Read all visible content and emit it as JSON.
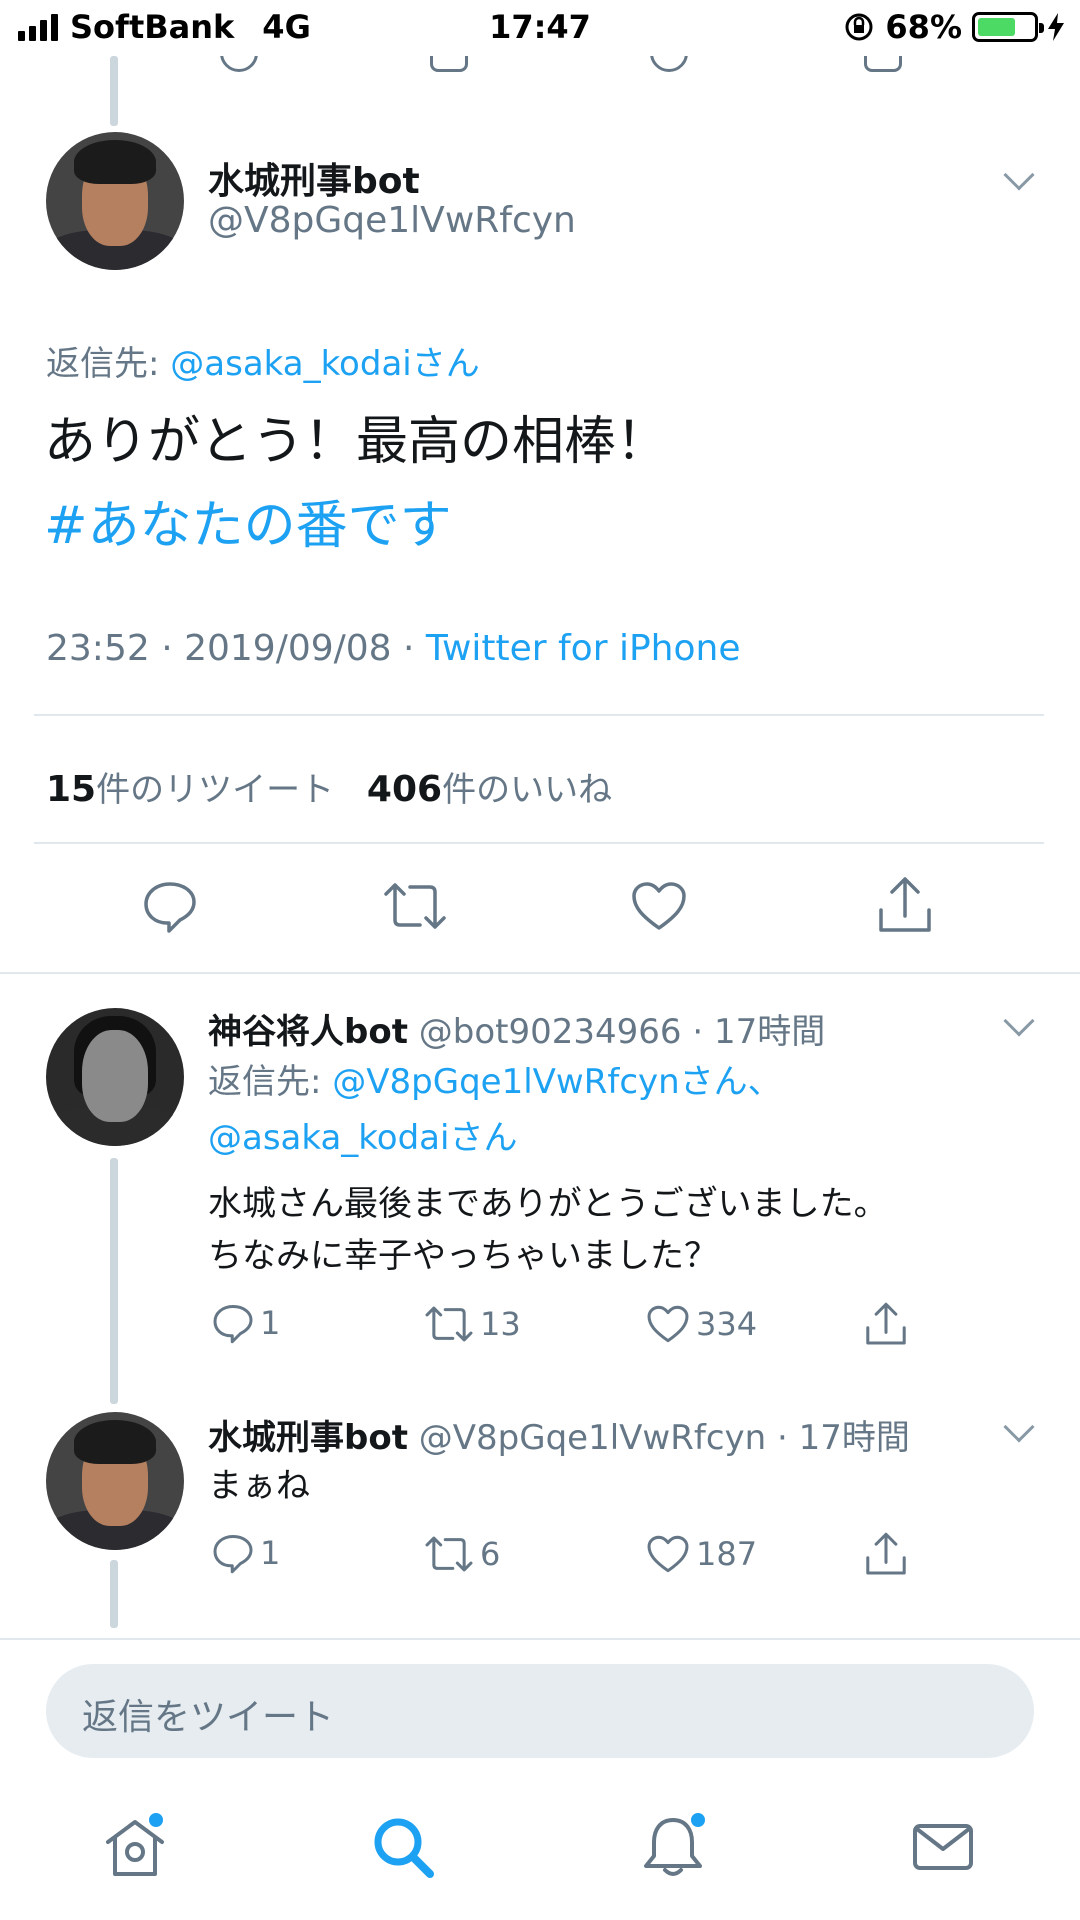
{
  "status_bar": {
    "carrier": "SoftBank",
    "network": "4G",
    "time": "17:47",
    "battery": "68%",
    "battery_level": 0.68,
    "icons": [
      "signal-icon",
      "rotation-lock-icon",
      "battery-icon",
      "charging-icon"
    ]
  },
  "main_tweet": {
    "name": "水城刑事bot",
    "handle": "@V8pGqe1lVwRfcyn",
    "reply_prefix": "返信先: ",
    "reply_to": "@asaka_kodaiさん",
    "text": "ありがとう！最高の相棒！",
    "hashtag": "#あなたの番です",
    "timestamp": "23:52 · 2019/09/08 · ",
    "source": "Twitter for iPhone",
    "retweet_count": "15",
    "retweet_label": "件のリツイート",
    "like_count": "406",
    "like_label": "件のいいね"
  },
  "replies": [
    {
      "name": "神谷将人bot",
      "handle": "@bot90234966 · 17時間",
      "reply_prefix": "返信先: ",
      "reply_to_1": "@V8pGqe1lVwRfcynさん、",
      "reply_to_2": "@asaka_kodaiさん",
      "text_1": "水城さん最後までありがとうございました。",
      "text_2": "ちなみに幸子やっちゃいました？",
      "replies": "1",
      "retweets": "13",
      "likes": "334"
    },
    {
      "name": "水城刑事bot",
      "handle": "@V8pGqe1lVwRfcyn · 17時間",
      "text_1": "まぁね",
      "replies": "1",
      "retweets": "6",
      "likes": "187"
    }
  ],
  "compose": {
    "placeholder": "返信をツイート"
  },
  "tab_bar": {
    "tabs": [
      "home-icon",
      "search-icon",
      "notifications-icon",
      "messages-icon"
    ],
    "active": "search-icon",
    "accent": "#1da1f2"
  }
}
